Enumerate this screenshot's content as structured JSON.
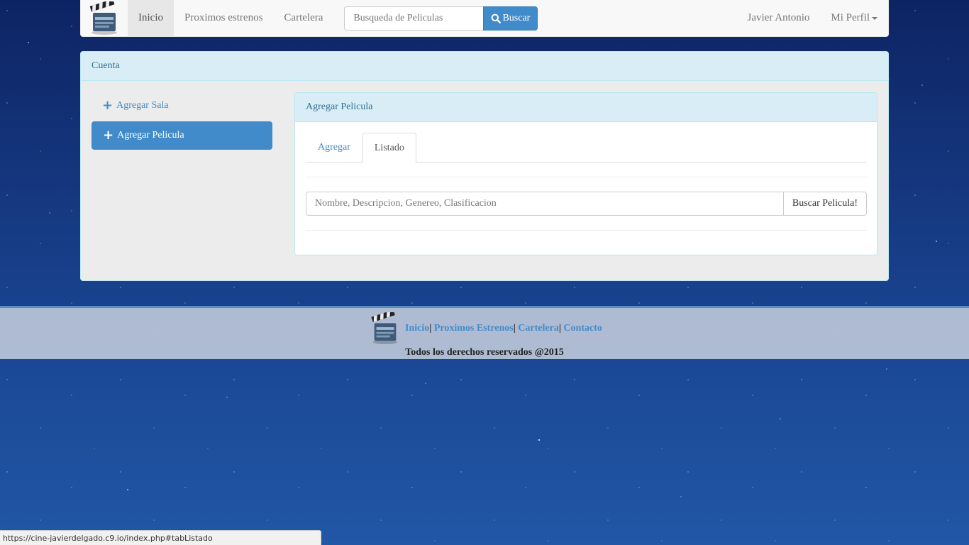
{
  "navbar": {
    "brand_icon": "clapperboard-icon",
    "links": [
      {
        "label": "Inicio",
        "active": true
      },
      {
        "label": "Proximos estrenos",
        "active": false
      },
      {
        "label": "Cartelera",
        "active": false
      }
    ],
    "search": {
      "placeholder": "Busqueda de Peliculas",
      "button_label": "Buscar",
      "button_icon": "search-icon"
    },
    "user_name": "Javier Antonio",
    "profile_menu": "Mi Perfil"
  },
  "account_panel": {
    "heading": "Cuenta",
    "sidebar": [
      {
        "label": "Agregar Sala",
        "icon": "plus-icon",
        "active": false
      },
      {
        "label": "Agregar Pelicula",
        "icon": "plus-icon",
        "active": true
      }
    ]
  },
  "movie_panel": {
    "heading": "Agregar Pelicula",
    "tabs": [
      {
        "label": "Agregar",
        "active": false
      },
      {
        "label": "Listado",
        "active": true
      }
    ],
    "search": {
      "placeholder": "Nombre, Descripcion, Genereo, Clasificacion",
      "button_label": "Buscar Pelicula!"
    }
  },
  "footer": {
    "logo_icon": "clapperboard-icon",
    "links": [
      "Inicio",
      "Proximos Estrenos",
      "Cartelera",
      "Contacto"
    ],
    "separator": "|",
    "copyright": "Todos los derechos reservados @2015"
  },
  "status_bar": {
    "url": "https://cine-javierdelgado.c9.io/index.php#tabListado"
  },
  "colors": {
    "primary": "#428bca",
    "panel_heading_bg": "#d9edf7",
    "panel_heading_text": "#31708f",
    "space_bg": "#15377f"
  }
}
